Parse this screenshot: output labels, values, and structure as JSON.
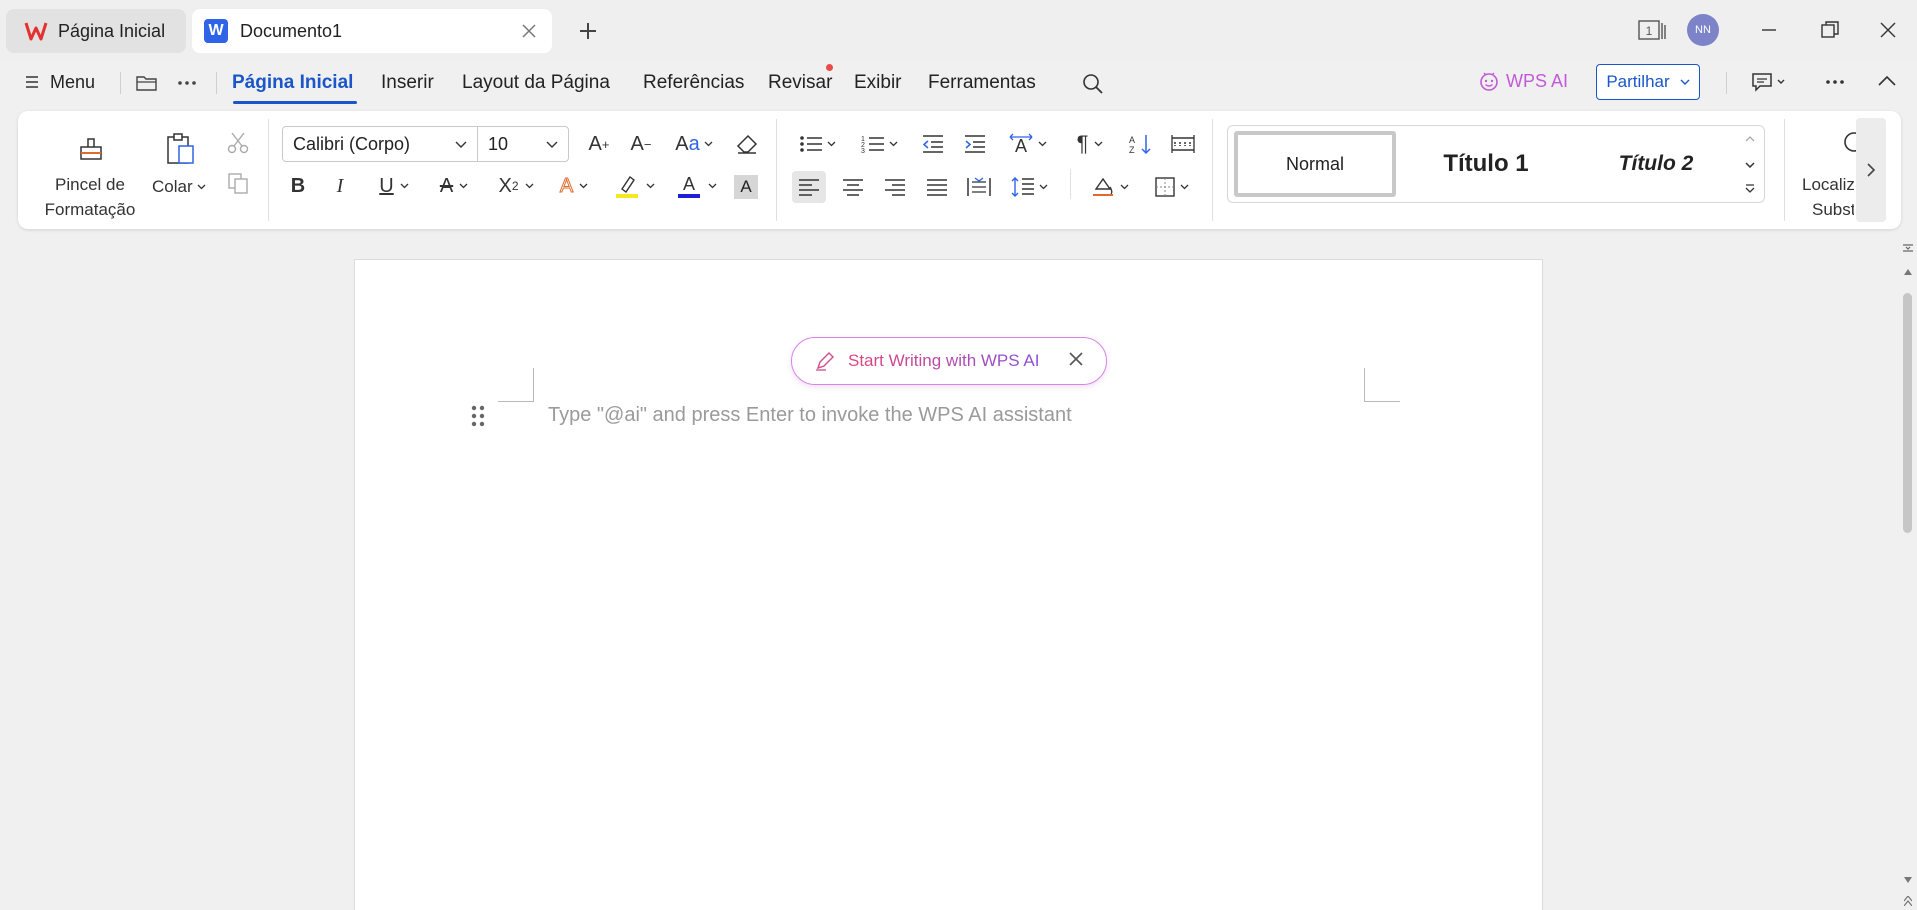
{
  "tabs": {
    "home_label": "Página Inicial",
    "doc_label": "Documento1"
  },
  "window": {
    "avatar_initials": "NN",
    "page_count_badge": "1"
  },
  "menubar": {
    "menu_label": "Menu",
    "tabs": [
      "Página Inicial",
      "Inserir",
      "Layout da Página",
      "Referências",
      "Revisar",
      "Exibir",
      "Ferramentas"
    ],
    "wps_ai_label": "WPS AI",
    "share_label": "Partilhar"
  },
  "ribbon": {
    "format_painter_line1": "Pincel de",
    "format_painter_line2": "Formatação",
    "paste_label": "Colar",
    "font_name": "Calibri (Corpo)",
    "font_size": "10",
    "styles": {
      "normal": "Normal",
      "title1": "Título 1",
      "title2": "Título 2"
    },
    "find_replace_line1": "Localiz",
    "find_replace_line2": "Subst"
  },
  "document": {
    "ai_prompt_button": "Start Writing with WPS AI",
    "placeholder": "Type \"@ai\" and press Enter to invoke the WPS AI assistant"
  },
  "colors": {
    "accent_blue": "#1a56c9",
    "ai_pink": "#d04c8e",
    "ai_purple": "#8b4fd8",
    "highlight_yellow": "#f5e81c",
    "font_color_blue": "#1f1fd8"
  }
}
